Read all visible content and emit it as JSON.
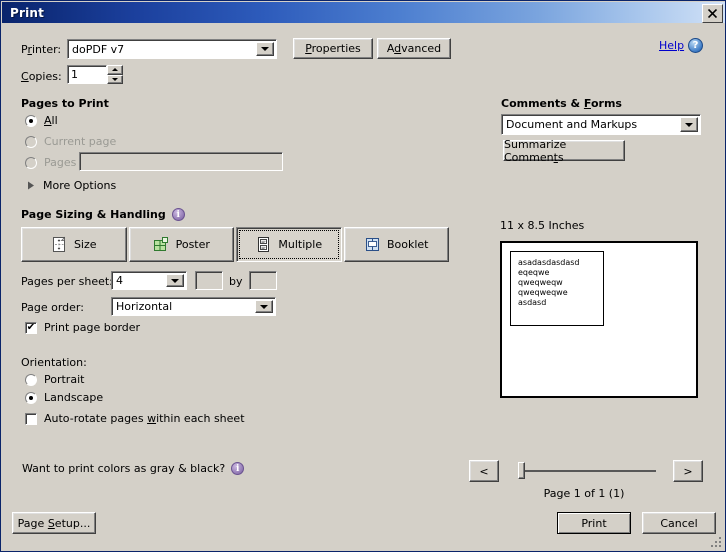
{
  "window": {
    "title": "Print",
    "close_label": "×"
  },
  "help": {
    "label": "Help",
    "icon": "question-mark-icon",
    "glyph": "?"
  },
  "printer": {
    "label": "Printer:",
    "label_prefix": "P",
    "label_accel": "r",
    "label_suffix": "inter:",
    "value": "doPDF v7",
    "properties_button": "Properties",
    "advanced_button": "Advanced"
  },
  "copies": {
    "label": "Copies:",
    "value": "1"
  },
  "pages_to_print": {
    "heading": "Pages to Print",
    "options": [
      {
        "label": "All",
        "selected": true,
        "disabled": false
      },
      {
        "label": "Current page",
        "selected": false,
        "disabled": true
      },
      {
        "label": "Pages",
        "selected": false,
        "disabled": true
      }
    ],
    "pages_field_value": "",
    "more_options": "More Options"
  },
  "page_sizing": {
    "heading": "Page Sizing & Handling",
    "info_icon": "info-icon",
    "buttons": [
      {
        "label": "Size",
        "icon": "size-icon",
        "selected": false
      },
      {
        "label": "Poster",
        "icon": "poster-icon",
        "selected": false
      },
      {
        "label": "Multiple",
        "icon": "multiple-icon",
        "selected": true
      },
      {
        "label": "Booklet",
        "icon": "booklet-icon",
        "selected": false
      }
    ],
    "pages_per_sheet_label": "Pages per sheet:",
    "pages_per_sheet_value": "4",
    "by_label": "by",
    "custom_rows_value": "",
    "custom_cols_value": "",
    "page_order_label": "Page order:",
    "page_order_value": "Horizontal",
    "print_page_border_label": "Print page border",
    "print_page_border_checked": true,
    "check_glyph": "✔"
  },
  "orientation": {
    "heading": "Orientation:",
    "options": [
      {
        "label": "Portrait",
        "selected": false
      },
      {
        "label": "Landscape",
        "selected": true
      }
    ],
    "auto_rotate_label": "Auto-rotate pages within each sheet",
    "auto_rotate_checked": false,
    "gray_black_question": "Want to print colors as gray & black?",
    "gray_black_info_icon": "info-icon"
  },
  "comments_forms": {
    "heading": "Comments & Forms",
    "select_value": "Document and Markups",
    "summarize_button": "Summarize Comments"
  },
  "preview": {
    "size_label": "11 x 8.5 Inches",
    "page_lines": [
      "asadasdasdasd",
      "eqeqwe",
      "qweqweqw",
      "qweqweqwe",
      "asdasd"
    ],
    "prev_button": "<",
    "next_button": ">",
    "page_status": "Page 1 of 1 (1)"
  },
  "footer": {
    "page_setup_button": "Page Setup...",
    "print_button": "Print",
    "cancel_button": "Cancel"
  },
  "colors": {
    "title_bar_start": "#09246c",
    "title_bar_end": "#d2e2f7",
    "dialog_face": "#d4d0c8",
    "link_blue": "#0000cc",
    "disabled_text": "#9a9a94"
  }
}
